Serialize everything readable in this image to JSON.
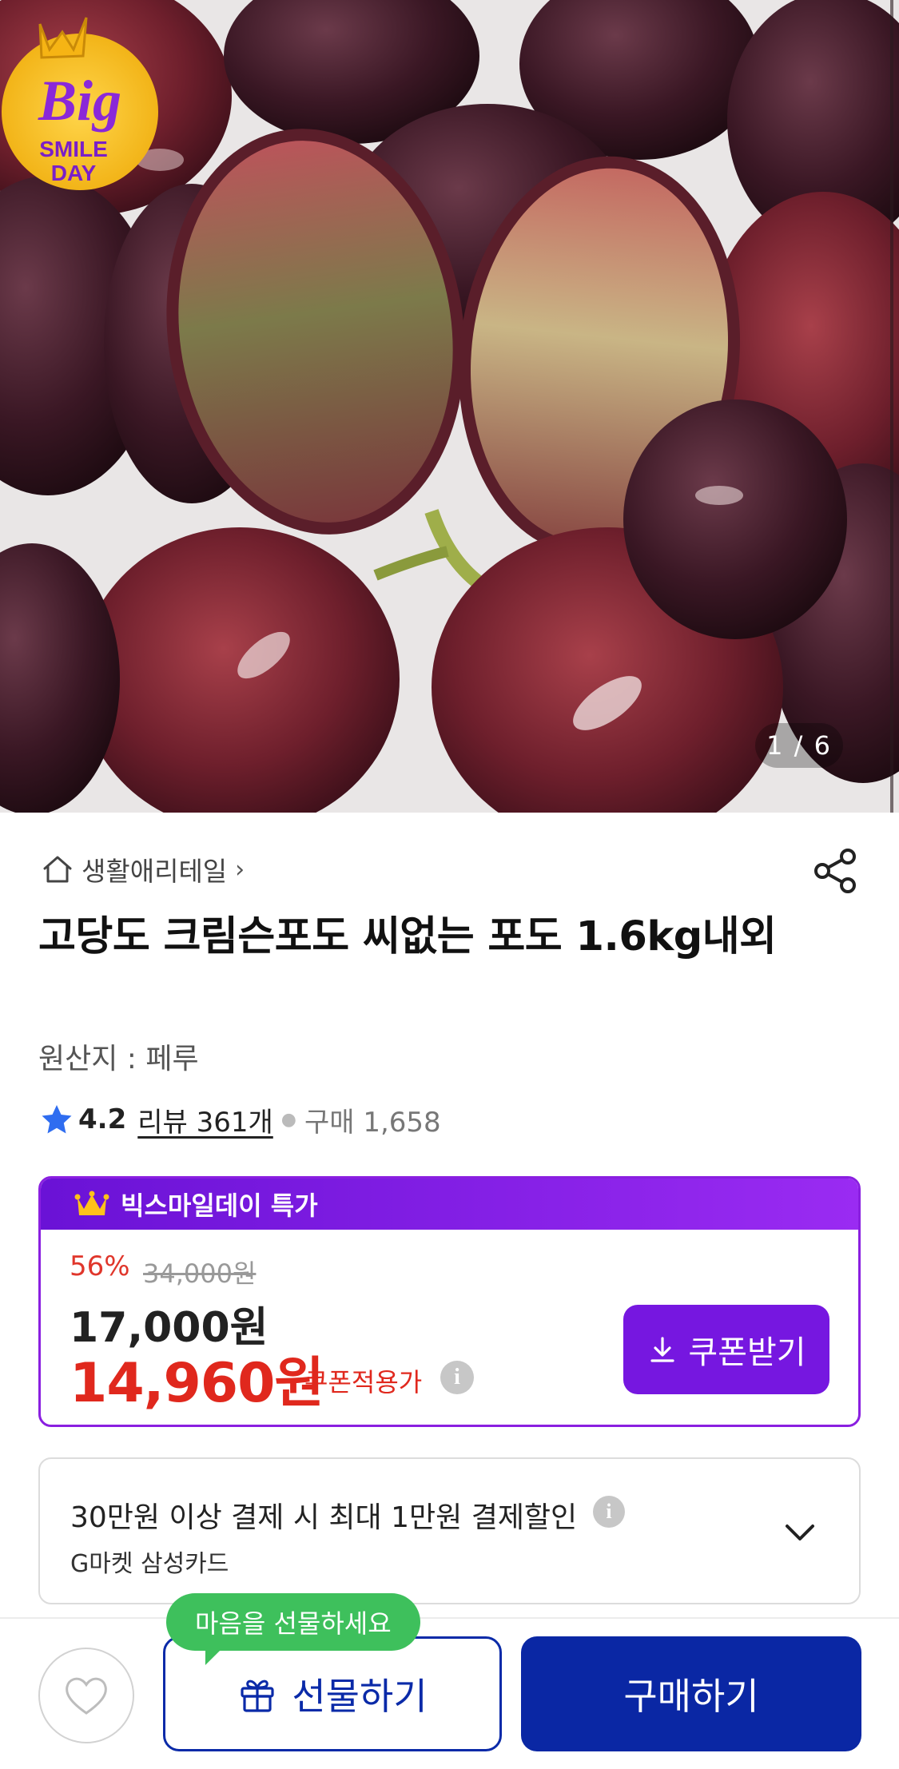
{
  "hero": {
    "counter": "1 / 6",
    "badge": {
      "line1": "Big",
      "line2": "SMILE",
      "line3": "DAY"
    }
  },
  "breadcrumb": {
    "category": "생활애리테일",
    "chevron": "›"
  },
  "product": {
    "title": "고당도 크림슨포도 씨없는 포도 1.6kg내외",
    "origin": "원산지 : 페루",
    "rating": "4.2",
    "reviews": "리뷰 361개",
    "purchases": "구매 1,658"
  },
  "deal": {
    "header": "빅스마일데이 특가",
    "discount": "56%",
    "original_price": "34,000원",
    "sale_price": "17,000원",
    "coupon_price": "14,960원",
    "coupon_label": "쿠폰적용가",
    "coupon_button": "쿠폰받기"
  },
  "card_offer": {
    "main": "30만원 이상 결제 시 최대 1만원 결제할인",
    "sub": "G마켓 삼성카드"
  },
  "bottom": {
    "tooltip": "마음을 선물하세요",
    "gift_button": "선물하기",
    "buy_button": "구매하기"
  },
  "colors": {
    "accent_purple": "#7617e0",
    "price_red": "#e0281d",
    "primary_blue": "#0a27a4",
    "tooltip_green": "#3ec05c",
    "star_blue": "#2f6df0"
  },
  "icons": [
    "home-icon",
    "share-icon",
    "star-icon",
    "crown-icon",
    "download-icon",
    "info-icon",
    "chevron-down-icon",
    "heart-icon",
    "gift-icon"
  ]
}
